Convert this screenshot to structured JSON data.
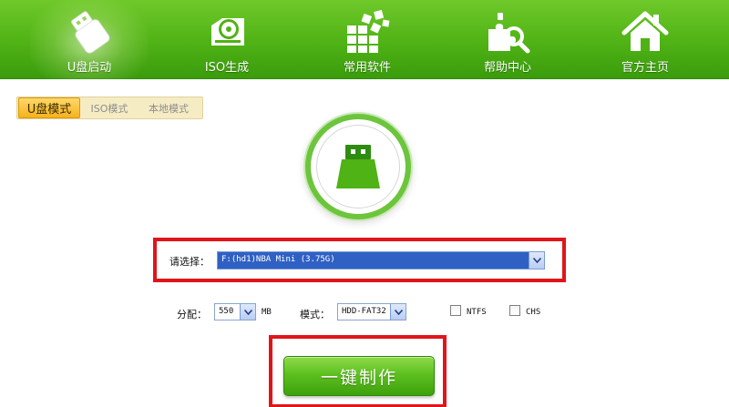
{
  "nav": {
    "items": [
      {
        "label": "U盘启动",
        "icon": "usb-drive-icon",
        "active": true
      },
      {
        "label": "ISO生成",
        "icon": "disc-icon",
        "active": false
      },
      {
        "label": "常用软件",
        "icon": "apps-grid-icon",
        "active": false
      },
      {
        "label": "帮助中心",
        "icon": "help-magnifier-icon",
        "active": false
      },
      {
        "label": "官方主页",
        "icon": "home-icon",
        "active": false
      }
    ]
  },
  "mode_tabs": [
    {
      "label": "U盘模式",
      "active": true
    },
    {
      "label": "ISO模式",
      "active": false
    },
    {
      "label": "本地模式",
      "active": false
    }
  ],
  "device": {
    "label": "请选择：",
    "value": "F:(hd1)NBA Mini (3.75G)"
  },
  "options": {
    "alloc_label": "分配：",
    "alloc_value": "550",
    "alloc_unit": "MB",
    "mode_label": "模式：",
    "mode_value": "HDD-FAT32",
    "ntfs_label": "NTFS",
    "ntfs_checked": false,
    "chs_label": "CHS",
    "chs_checked": false
  },
  "make_button": {
    "label": "一键制作"
  },
  "colors": {
    "brand_green": "#4fb215",
    "highlight_red": "#e0151b",
    "tab_gold": "#f6b21d",
    "select_blue": "#2f61c4"
  }
}
